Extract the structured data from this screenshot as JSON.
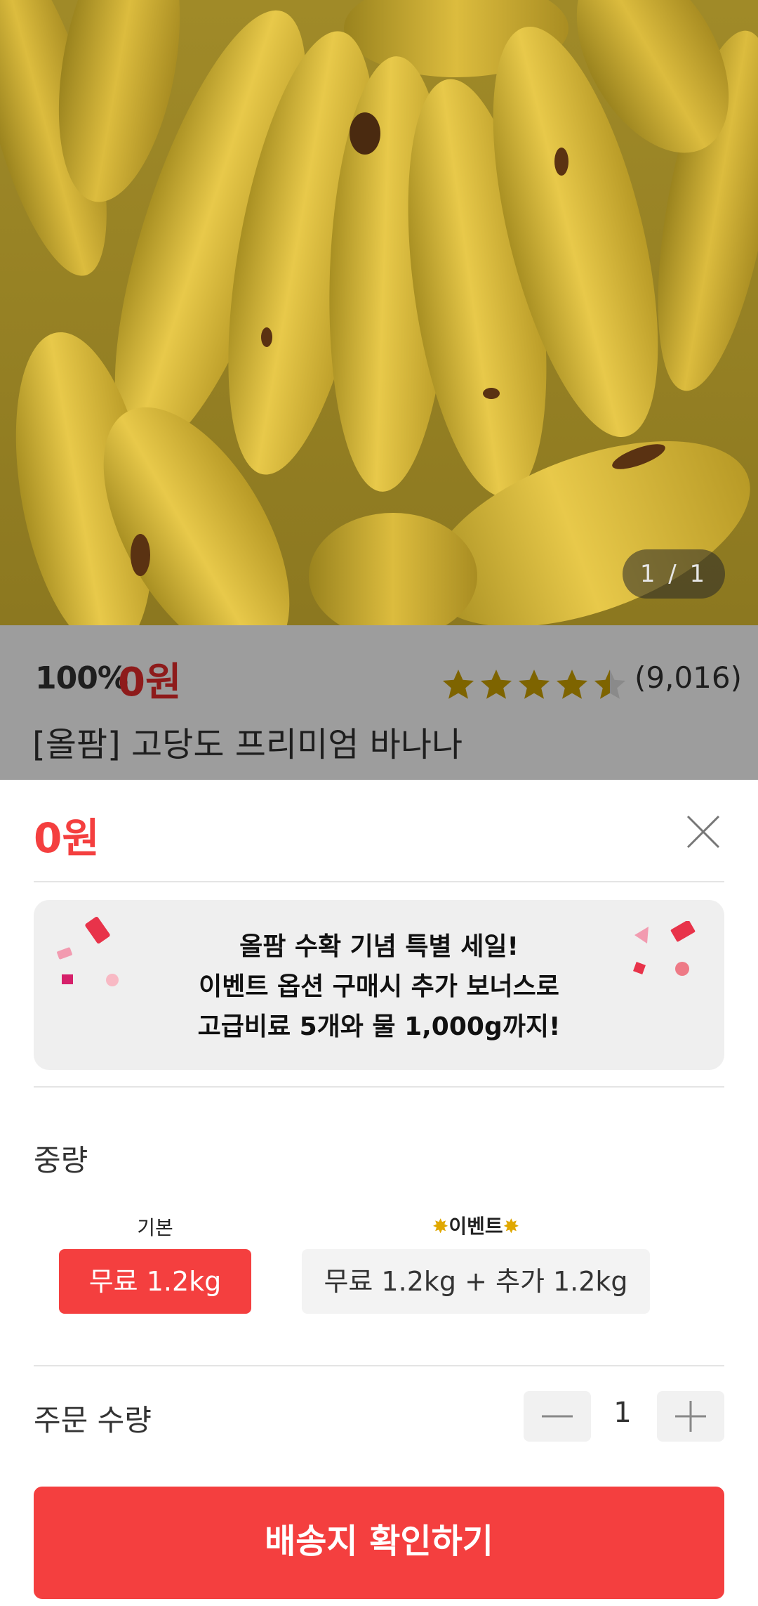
{
  "product_image": {
    "counter": "1 / 1"
  },
  "info": {
    "discount": "100%",
    "price": "0원",
    "rating": 4.5,
    "review_count": "(9,016)",
    "title": "[올팜] 고당도 프리미엄 바나나"
  },
  "sheet": {
    "price": "0원",
    "banner": {
      "line1": "올팜 수확 기념 특별 세일!",
      "line2": "이벤트 옵션 구매시 추가 보너스로",
      "line3": "고급비료 5개와 물 1,000g까지!"
    },
    "weight": {
      "label": "중량",
      "options": [
        {
          "caption": "기본",
          "label": "무료 1.2kg",
          "selected": true
        },
        {
          "caption": "이벤트",
          "label": "무료 1.2kg + 추가 1.2kg",
          "selected": false
        }
      ]
    },
    "quantity": {
      "label": "주문 수량",
      "value": "1"
    },
    "cta_label": "배송지 확인하기"
  },
  "colors": {
    "accent": "#f43f3f",
    "star": "#c9a100",
    "dim_overlay": "#9d9d9d"
  }
}
